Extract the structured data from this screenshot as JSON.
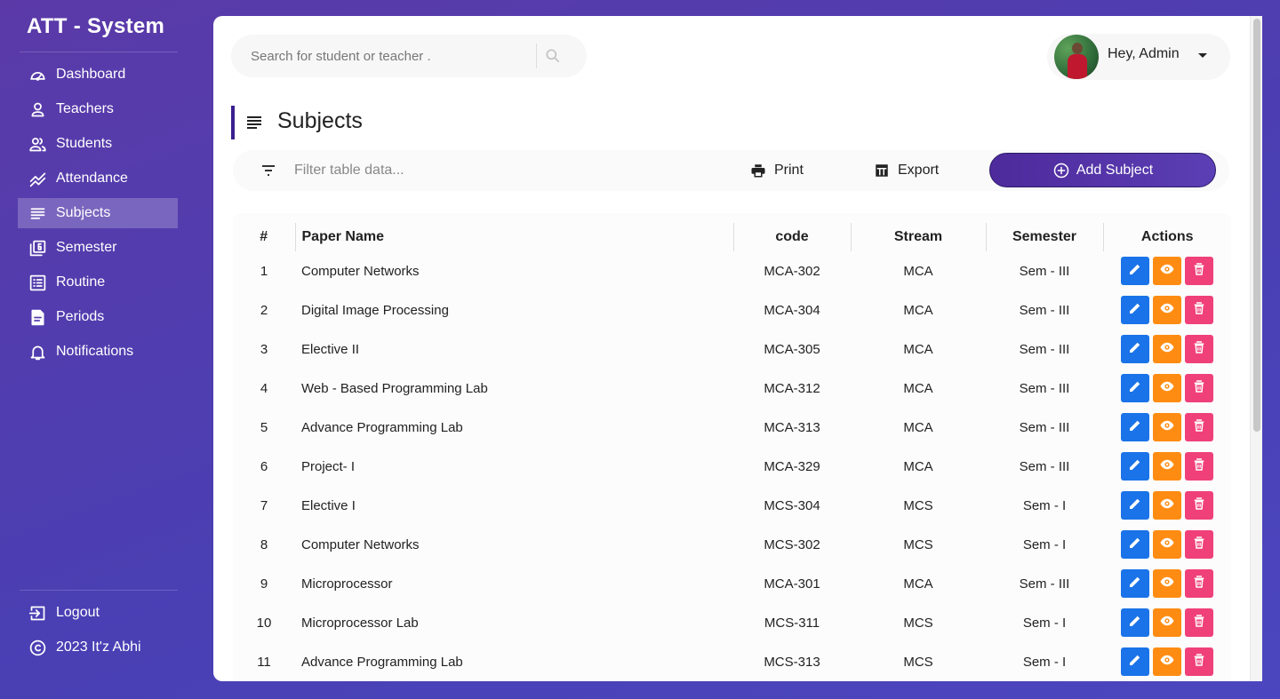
{
  "brand": "ATT - System",
  "sidebar": {
    "items": [
      {
        "label": "Dashboard",
        "icon": "gauge-icon"
      },
      {
        "label": "Teachers",
        "icon": "person-icon"
      },
      {
        "label": "Students",
        "icon": "people-icon"
      },
      {
        "label": "Attendance",
        "icon": "trend-icon"
      },
      {
        "label": "Subjects",
        "icon": "list-icon",
        "active": true
      },
      {
        "label": "Semester",
        "icon": "filter-6-icon"
      },
      {
        "label": "Routine",
        "icon": "checklist-icon"
      },
      {
        "label": "Periods",
        "icon": "document-icon"
      },
      {
        "label": "Notifications",
        "icon": "bell-icon"
      }
    ],
    "footer": [
      {
        "label": "Logout",
        "icon": "logout-icon"
      },
      {
        "label": "2023 It'z Abhi",
        "icon": "copyright-icon"
      }
    ]
  },
  "search": {
    "placeholder": "Search for student or teacher ."
  },
  "profile": {
    "greeting": "Hey, Admin"
  },
  "page_title": "Subjects",
  "toolbar": {
    "filter_placeholder": "Filter table data...",
    "print_label": "Print",
    "export_label": "Export",
    "add_label": "Add Subject"
  },
  "table": {
    "headers": {
      "num": "#",
      "name": "Paper Name",
      "code": "code",
      "stream": "Stream",
      "semester": "Semester",
      "actions": "Actions"
    },
    "rows": [
      {
        "num": "1",
        "name": "Computer Networks",
        "code": "MCA-302",
        "stream": "MCA",
        "semester": "Sem - III"
      },
      {
        "num": "2",
        "name": "Digital Image Processing",
        "code": "MCA-304",
        "stream": "MCA",
        "semester": "Sem - III"
      },
      {
        "num": "3",
        "name": "Elective II",
        "code": "MCA-305",
        "stream": "MCA",
        "semester": "Sem - III"
      },
      {
        "num": "4",
        "name": "Web - Based Programming Lab",
        "code": "MCA-312",
        "stream": "MCA",
        "semester": "Sem - III"
      },
      {
        "num": "5",
        "name": "Advance Programming Lab",
        "code": "MCA-313",
        "stream": "MCA",
        "semester": "Sem - III"
      },
      {
        "num": "6",
        "name": "Project- I",
        "code": "MCA-329",
        "stream": "MCA",
        "semester": "Sem - III"
      },
      {
        "num": "7",
        "name": "Elective I",
        "code": "MCS-304",
        "stream": "MCS",
        "semester": "Sem - I"
      },
      {
        "num": "8",
        "name": "Computer Networks",
        "code": "MCS-302",
        "stream": "MCS",
        "semester": "Sem - I"
      },
      {
        "num": "9",
        "name": "Microprocessor",
        "code": "MCA-301",
        "stream": "MCA",
        "semester": "Sem - III"
      },
      {
        "num": "10",
        "name": "Microprocessor Lab",
        "code": "MCS-311",
        "stream": "MCS",
        "semester": "Sem - I"
      },
      {
        "num": "11",
        "name": "Advance Programming Lab",
        "code": "MCS-313",
        "stream": "MCS",
        "semester": "Sem - I"
      }
    ]
  },
  "colors": {
    "accent": "#4e2a9c",
    "edit": "#1a73e8",
    "view": "#ff8c12",
    "delete": "#f0407a"
  }
}
